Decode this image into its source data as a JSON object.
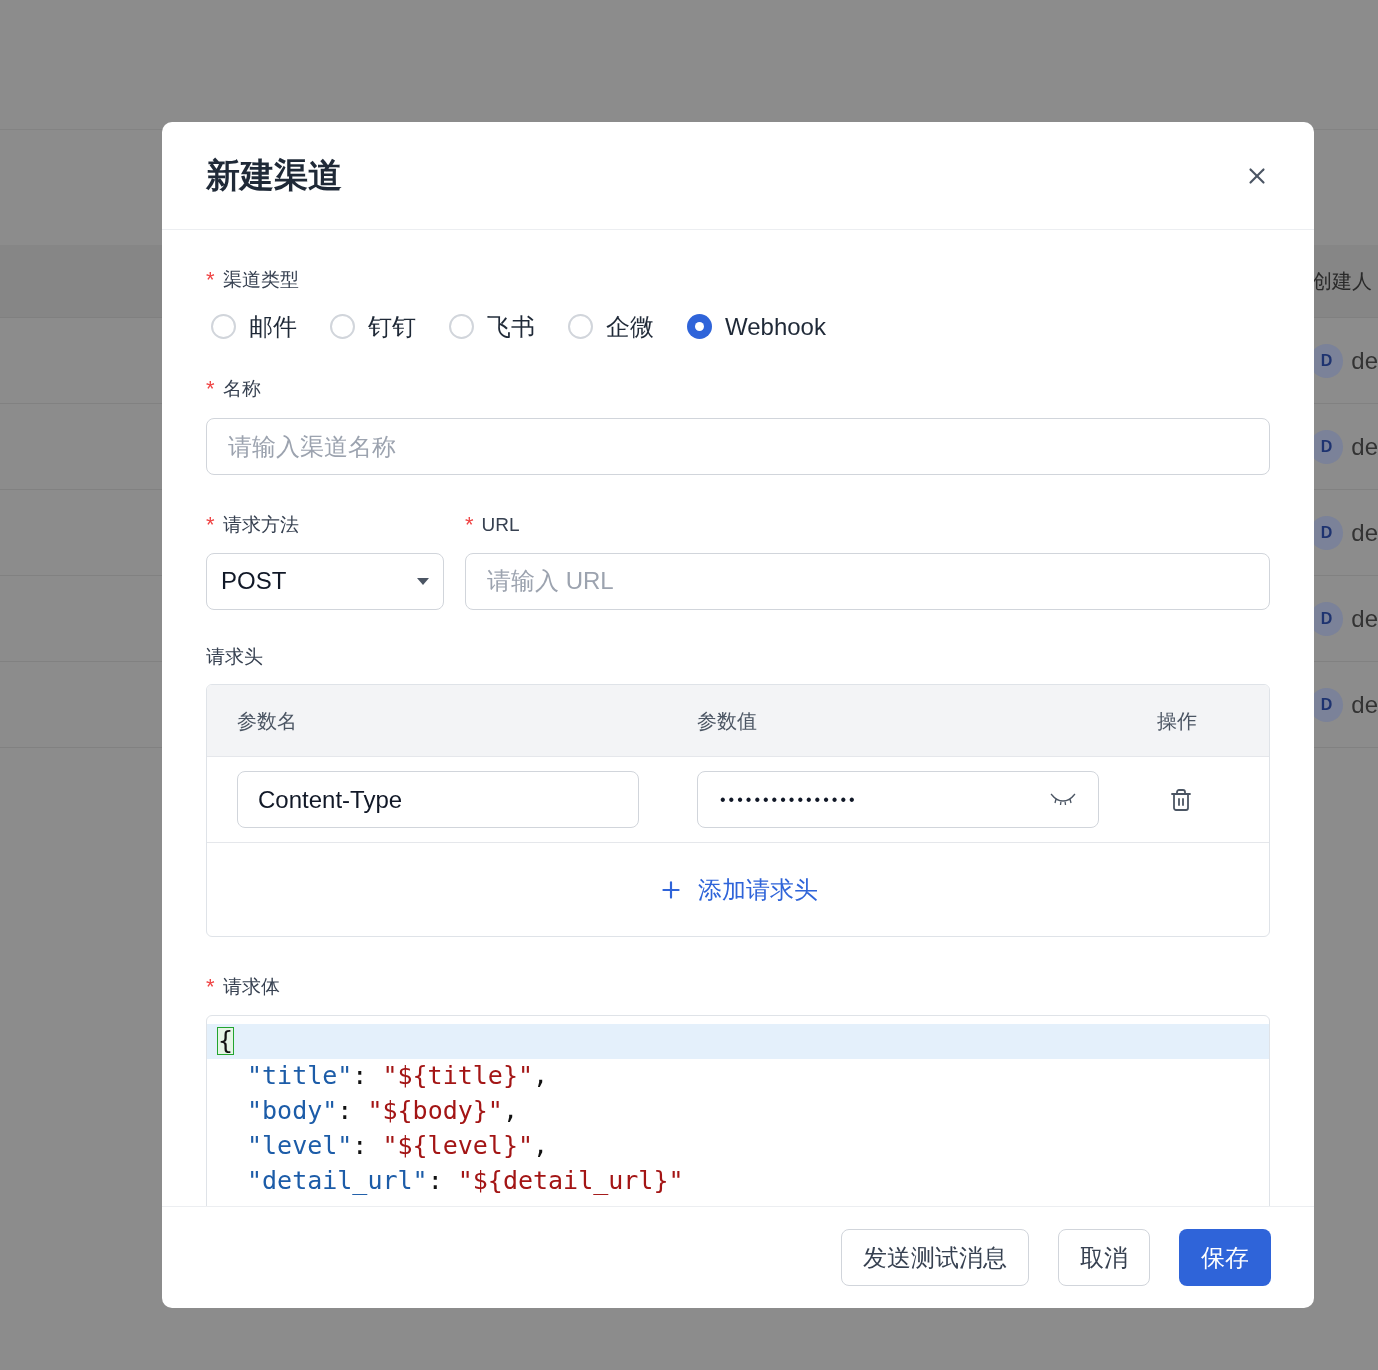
{
  "background_table": {
    "column_header": "创建人",
    "rows": [
      {
        "avatar": "D",
        "text": "de"
      },
      {
        "avatar": "D",
        "text": "de"
      },
      {
        "avatar": "D",
        "text": "de"
      },
      {
        "avatar": "D",
        "text": "de"
      },
      {
        "avatar": "D",
        "text": "de"
      }
    ]
  },
  "dialog": {
    "title": "新建渠道",
    "channel_type": {
      "label": "渠道类型",
      "required": "*",
      "options": [
        {
          "label": "邮件",
          "selected": false
        },
        {
          "label": "钉钉",
          "selected": false
        },
        {
          "label": "飞书",
          "selected": false
        },
        {
          "label": "企微",
          "selected": false
        },
        {
          "label": "Webhook",
          "selected": true
        }
      ]
    },
    "name": {
      "label": "名称",
      "required": "*",
      "placeholder": "请输入渠道名称"
    },
    "method": {
      "label": "请求方法",
      "required": "*",
      "value": "POST"
    },
    "url": {
      "label": "URL",
      "required": "*",
      "placeholder": "请输入 URL"
    },
    "headers": {
      "label": "请求头",
      "columns": [
        "参数名",
        "参数值",
        "操作"
      ],
      "rows": [
        {
          "name": "Content-Type",
          "value": "••••••••••••••••"
        }
      ],
      "add_button": "添加请求头"
    },
    "body": {
      "label": "请求体",
      "required": "*",
      "lines": [
        {
          "active": true,
          "tokens": [
            {
              "kind": "bracket",
              "text": "{"
            }
          ]
        },
        {
          "active": false,
          "tokens": [
            {
              "kind": "key",
              "text": "\"title\""
            },
            {
              "kind": "punct",
              "text": ": "
            },
            {
              "kind": "string",
              "text": "\"${title}\""
            },
            {
              "kind": "punct",
              "text": ","
            }
          ]
        },
        {
          "active": false,
          "tokens": [
            {
              "kind": "key",
              "text": "\"body\""
            },
            {
              "kind": "punct",
              "text": ": "
            },
            {
              "kind": "string",
              "text": "\"${body}\""
            },
            {
              "kind": "punct",
              "text": ","
            }
          ]
        },
        {
          "active": false,
          "tokens": [
            {
              "kind": "key",
              "text": "\"level\""
            },
            {
              "kind": "punct",
              "text": ": "
            },
            {
              "kind": "string",
              "text": "\"${level}\""
            },
            {
              "kind": "punct",
              "text": ","
            }
          ]
        },
        {
          "active": false,
          "tokens": [
            {
              "kind": "key",
              "text": "\"detail_url\""
            },
            {
              "kind": "punct",
              "text": ": "
            },
            {
              "kind": "string",
              "text": "\"${detail_url}\""
            }
          ]
        }
      ]
    },
    "buttons": [
      {
        "label": "发送测试消息",
        "kind": "default"
      },
      {
        "label": "取消",
        "kind": "default"
      },
      {
        "label": "保存",
        "kind": "primary"
      }
    ]
  }
}
